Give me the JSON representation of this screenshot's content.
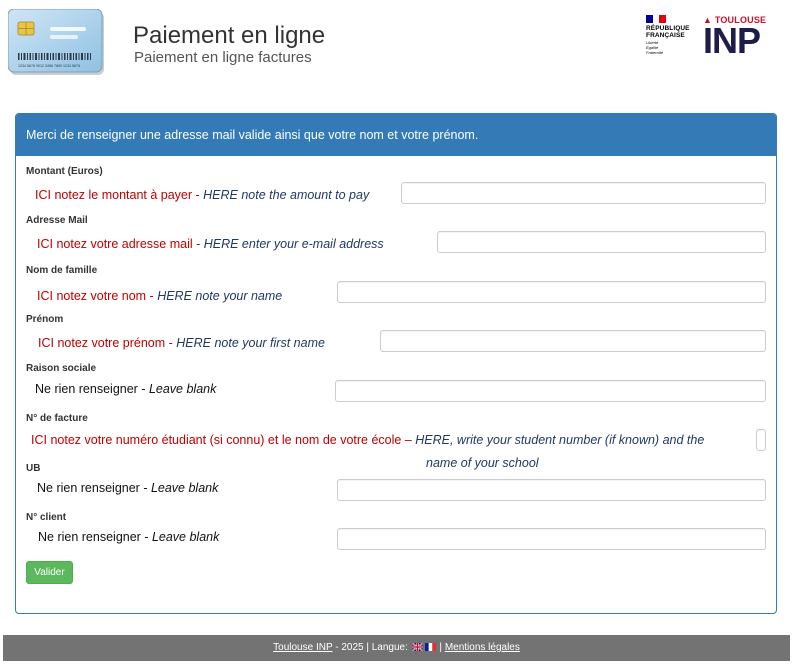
{
  "header": {
    "title": "Paiement en ligne",
    "subtitle": "Paiement en ligne factures",
    "card_number_text": "1234 5678 9012 3456 7890 1234 5678",
    "rf_logo": {
      "line1": "RÉPUBLIQUE",
      "line2": "FRANÇAISE",
      "motto1": "Liberté",
      "motto2": "Égalité",
      "motto3": "Fraternité"
    },
    "inp_logo": {
      "top": "TOULOUSE",
      "main": "INP"
    }
  },
  "panel": {
    "heading": "Merci de renseigner une adresse mail valide ainsi que votre nom et votre prénom.",
    "fields": [
      {
        "label": "Montant (Euros)",
        "fr": "ICI notez le montant à payer",
        "sep": " - ",
        "en": "HERE note the amount to pay"
      },
      {
        "label": "Adresse Mail",
        "fr": "ICI notez votre adresse mail",
        "sep": " - ",
        "en": "HERE enter your e-mail address"
      },
      {
        "label": "Nom de famille",
        "fr": "ICI notez votre nom",
        "sep": " - ",
        "en": "HERE note your name"
      },
      {
        "label": "Prénom",
        "fr": "ICI notez votre prénom",
        "sep": " - ",
        "en": "HERE note your first name"
      },
      {
        "label": "Raison sociale",
        "fr": "Ne rien renseigner",
        "sep": " - ",
        "en": "Leave blank"
      },
      {
        "label": "N° de facture",
        "fr": "ICI notez votre numéro étudiant (si connu)  et le nom de votre école",
        "sep": " – ",
        "en": "HERE, write your student number (if known) and the",
        "en2": "name of your school"
      },
      {
        "label": "UB",
        "fr": "Ne rien renseigner",
        "sep": " - ",
        "en": "Leave blank"
      },
      {
        "label": "N° client",
        "fr": "Ne rien renseigner",
        "sep": " - ",
        "en": "Leave blank"
      }
    ],
    "submit_label": "Valider"
  },
  "footer": {
    "link_inp": "Toulouse INP",
    "year_text": " - 2025 | Langue: ",
    "sep": " | ",
    "link_legal": "Mentions légales"
  },
  "colors": {
    "panel_blue": "#337ab7",
    "submit_green": "#5cb85c",
    "footer_gray": "#737373",
    "overlay_red": "#c00000",
    "overlay_navy": "#1f3864"
  }
}
